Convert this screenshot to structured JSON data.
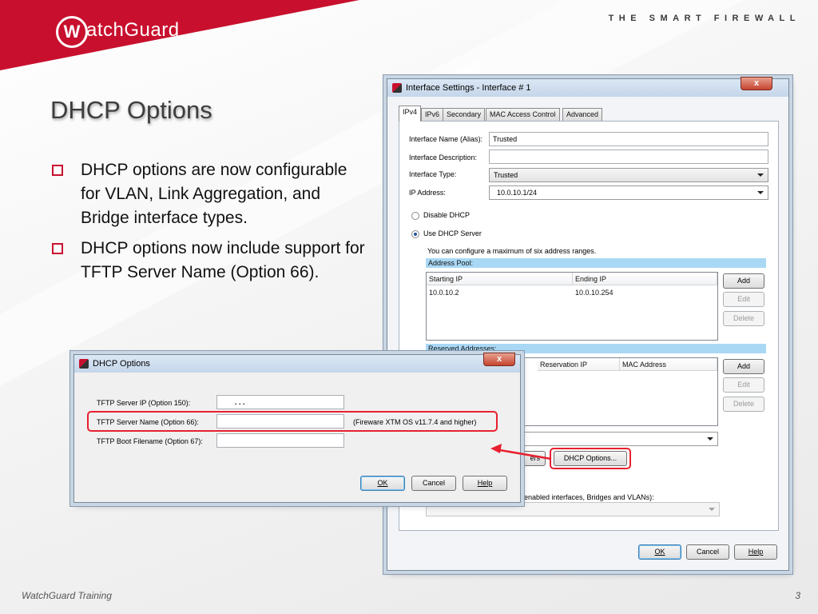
{
  "header": {
    "brand_mark": "W",
    "brand_name": "atchGuard",
    "tagline": "THE SMART FIREWALL"
  },
  "slide": {
    "title": "DHCP Options",
    "bullets": [
      "DHCP options are now configurable for VLAN, Link Aggregation, and Bridge interface types.",
      "DHCP options now include support for TFTP Server Name (Option 66)."
    ]
  },
  "interface_window": {
    "title": "Interface Settings - Interface # 1",
    "close": "x",
    "tabs": [
      "IPv4",
      "IPv6",
      "Secondary",
      "MAC Access Control",
      "Advanced"
    ],
    "interface_name_label": "Interface Name (Alias):",
    "interface_name_value": "Trusted",
    "interface_description_label": "Interface Description:",
    "interface_description_value": "",
    "interface_type_label": "Interface Type:",
    "interface_type_value": "Trusted",
    "ip_address_label": "IP Address:",
    "ip_address_value": "10.0.10.1/24",
    "disable_dhcp_label": "Disable DHCP",
    "use_dhcp_label": "Use DHCP Server",
    "address_range_note": "You can configure a maximum of six address ranges.",
    "address_pool_label": "Address Pool:",
    "pool_columns": [
      "Starting IP",
      "Ending IP"
    ],
    "pool_rows": [
      [
        "10.0.10.2",
        "10.0.10.254"
      ]
    ],
    "reserved_label": "Reserved Addresses:",
    "reserved_columns": [
      "Reservation IP",
      "MAC Address"
    ],
    "add_label": "Add",
    "edit_label": "Edit",
    "delete_label": "Delete",
    "partial_button_label": "ers",
    "dhcp_options_button": "DHCP Options...",
    "partial_text": "y enabled interfaces, Bridges and VLANs):",
    "ok_label": "OK",
    "cancel_label": "Cancel",
    "help_label": "Help"
  },
  "dhcp_dialog": {
    "title": "DHCP Options",
    "close": "x",
    "tftp_ip_label": "TFTP Server IP (Option 150):",
    "tftp_ip_value": ".     .     .",
    "tftp_name_label": "TFTP Server Name (Option 66):",
    "tftp_name_value": "",
    "tftp_name_note": "(Fireware XTM OS v11.7.4 and higher)",
    "boot_file_label": "TFTP Boot Filename (Option 67):",
    "boot_file_value": "",
    "ok_label": "OK",
    "cancel_label": "Cancel",
    "help_label": "Help"
  },
  "footer": {
    "left": "WatchGuard Training",
    "page": "3"
  },
  "colors": {
    "brand_red": "#c8102e",
    "highlight_red": "#e8202f",
    "section_blue": "#a9d8f5"
  }
}
